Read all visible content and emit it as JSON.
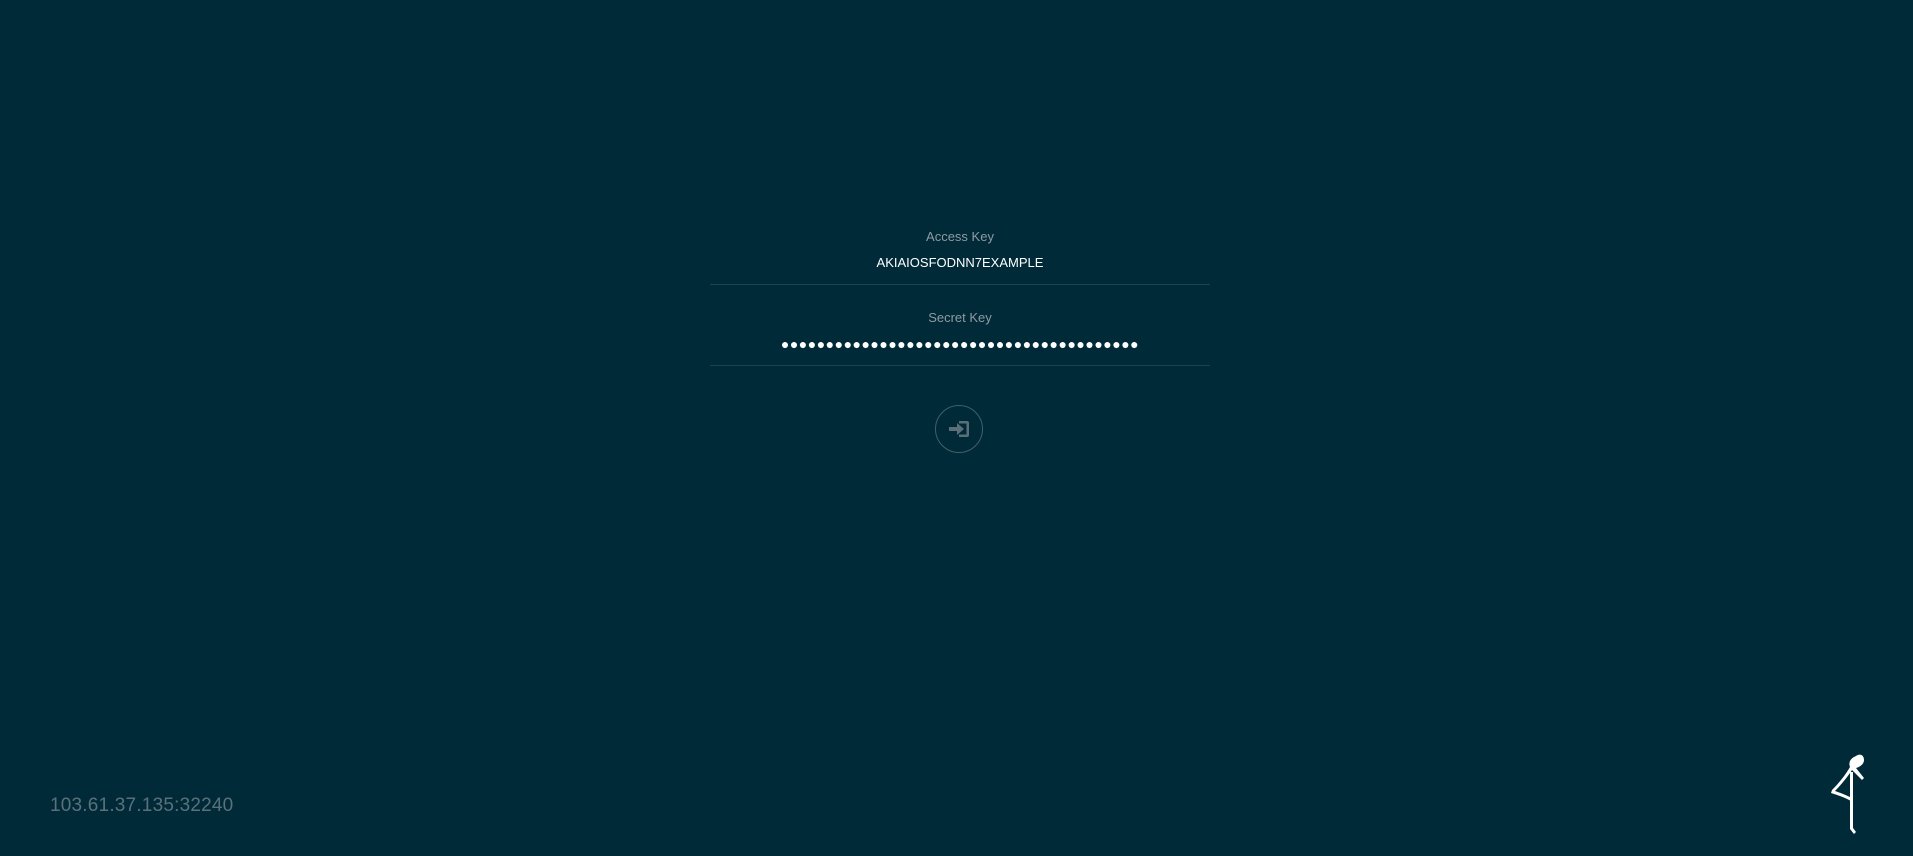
{
  "form": {
    "access_key": {
      "label": "Access Key",
      "value": "AKIAIOSFODNN7EXAMPLE"
    },
    "secret_key": {
      "label": "Secret Key",
      "masked_value": "●●●●●●●●●●●●●●●●●●●●●●●●●●●●●●●●●●●●●●●●"
    },
    "login_button": {
      "icon": "sign-in-icon"
    }
  },
  "footer": {
    "host": "103.61.37.135:32240",
    "logo": "minio-logo"
  },
  "colors": {
    "background": "#002a37",
    "label": "#8e9ba3",
    "value": "#ffffff",
    "host": "#5a717b"
  }
}
